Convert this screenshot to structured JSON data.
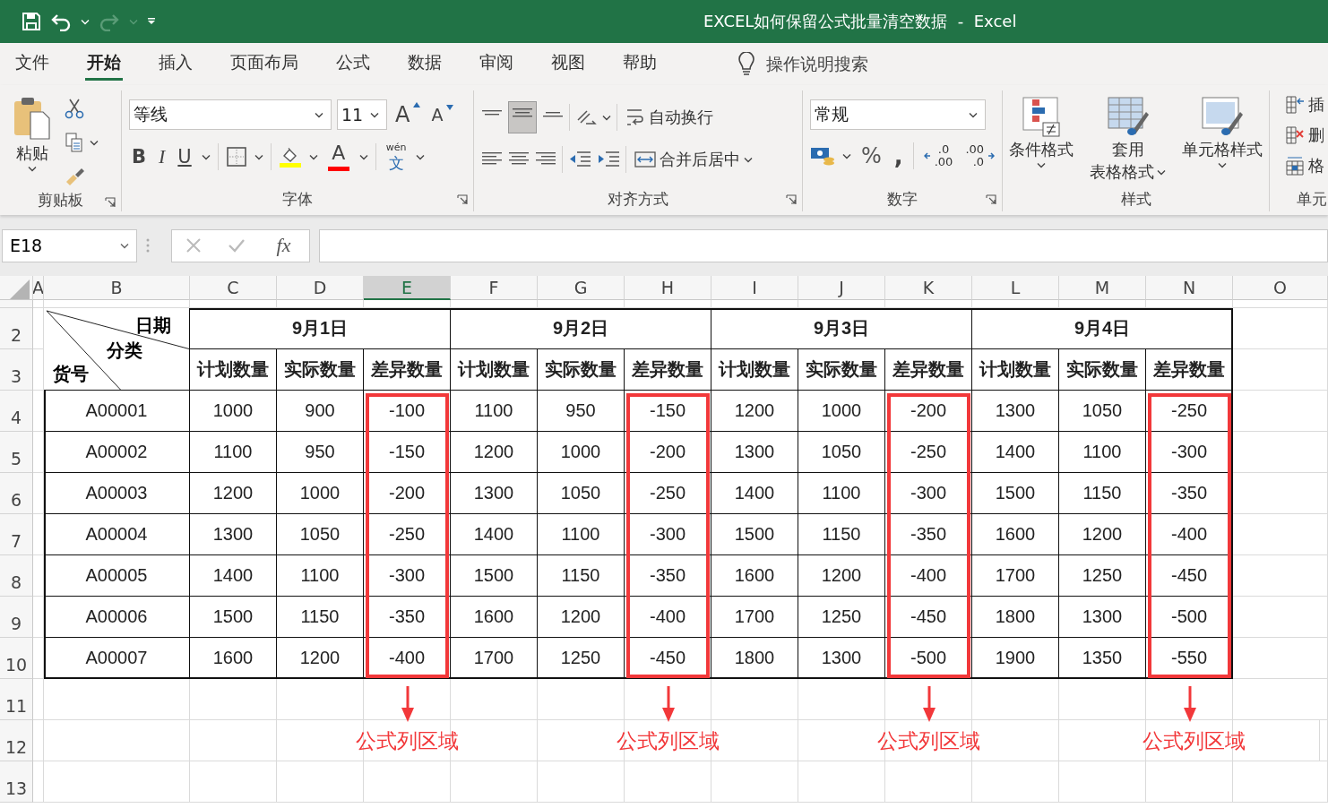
{
  "title_bar": {
    "title": "EXCEL如何保留公式批量清空数据  -  Excel"
  },
  "menu_tabs": [
    {
      "label": "文件",
      "selected": false
    },
    {
      "label": "开始",
      "selected": true
    },
    {
      "label": "插入",
      "selected": false
    },
    {
      "label": "页面布局",
      "selected": false
    },
    {
      "label": "公式",
      "selected": false
    },
    {
      "label": "数据",
      "selected": false
    },
    {
      "label": "审阅",
      "selected": false
    },
    {
      "label": "视图",
      "selected": false
    },
    {
      "label": "帮助",
      "selected": false
    }
  ],
  "tell_me": "操作说明搜索",
  "ribbon": {
    "clipboard": {
      "paste": "粘贴",
      "label": "剪贴板"
    },
    "font": {
      "font_name": "等线",
      "font_size": "11",
      "grow": "A",
      "shrink": "A",
      "bold": "B",
      "italic": "I",
      "underline": "U",
      "font_color": "A",
      "phonetic_top": "wén",
      "phonetic": "文",
      "label": "字体"
    },
    "alignment": {
      "wrap": "自动换行",
      "merge": "合并后居中",
      "label": "对齐方式"
    },
    "number": {
      "format": "常规",
      "percent": "%",
      "comma": ",",
      "increase_decimal": [
        ".0",
        ".00"
      ],
      "decrease_decimal": [
        ".00",
        ".0"
      ],
      "label": "数字"
    },
    "styles": {
      "conditional": "条件格式",
      "table_format": [
        "套用",
        "表格格式"
      ],
      "cell_styles": "单元格样式",
      "label": "样式"
    },
    "cells": {
      "insert": "插",
      "delete": "删",
      "format": "格",
      "label": "单元"
    }
  },
  "name_box": "E18",
  "formula_bar": {
    "fx": "fx"
  },
  "columns": [
    {
      "letter": "A",
      "selected": false
    },
    {
      "letter": "B",
      "selected": false
    },
    {
      "letter": "C",
      "selected": false
    },
    {
      "letter": "D",
      "selected": false
    },
    {
      "letter": "E",
      "selected": true
    },
    {
      "letter": "F",
      "selected": false
    },
    {
      "letter": "G",
      "selected": false
    },
    {
      "letter": "H",
      "selected": false
    },
    {
      "letter": "I",
      "selected": false
    },
    {
      "letter": "J",
      "selected": false
    },
    {
      "letter": "K",
      "selected": false
    },
    {
      "letter": "L",
      "selected": false
    },
    {
      "letter": "M",
      "selected": false
    },
    {
      "letter": "N",
      "selected": false
    },
    {
      "letter": "O",
      "selected": false
    }
  ],
  "rows": [
    "2",
    "3",
    "4",
    "5",
    "6",
    "7",
    "8",
    "9",
    "10",
    "11",
    "12",
    "13"
  ],
  "table": {
    "corner": {
      "top": "日期",
      "middle": "分类",
      "bottom": "货号"
    },
    "groups": [
      {
        "date": "9月1日",
        "headers": [
          "计划数量",
          "实际数量",
          "差异数量"
        ],
        "formula_note": "公式列区域"
      },
      {
        "date": "9月2日",
        "headers": [
          "计划数量",
          "实际数量",
          "差异数量"
        ],
        "formula_note": "公式列区域"
      },
      {
        "date": "9月3日",
        "headers": [
          "计划数量",
          "实际数量",
          "差异数量"
        ],
        "formula_note": "公式列区域"
      },
      {
        "date": "9月4日",
        "headers": [
          "计划数量",
          "实际数量",
          "差异数量"
        ],
        "formula_note": "公式列区域"
      }
    ],
    "rows": [
      {
        "id": "A00001",
        "cells": [
          "1000",
          "900",
          "-100",
          "1100",
          "950",
          "-150",
          "1200",
          "1000",
          "-200",
          "1300",
          "1050",
          "-250"
        ]
      },
      {
        "id": "A00002",
        "cells": [
          "1100",
          "950",
          "-150",
          "1200",
          "1000",
          "-200",
          "1300",
          "1050",
          "-250",
          "1400",
          "1100",
          "-300"
        ]
      },
      {
        "id": "A00003",
        "cells": [
          "1200",
          "1000",
          "-200",
          "1300",
          "1050",
          "-250",
          "1400",
          "1100",
          "-300",
          "1500",
          "1150",
          "-350"
        ]
      },
      {
        "id": "A00004",
        "cells": [
          "1300",
          "1050",
          "-250",
          "1400",
          "1100",
          "-300",
          "1500",
          "1150",
          "-350",
          "1600",
          "1200",
          "-400"
        ]
      },
      {
        "id": "A00005",
        "cells": [
          "1400",
          "1100",
          "-300",
          "1500",
          "1150",
          "-350",
          "1600",
          "1200",
          "-400",
          "1700",
          "1250",
          "-450"
        ]
      },
      {
        "id": "A00006",
        "cells": [
          "1500",
          "1150",
          "-350",
          "1600",
          "1200",
          "-400",
          "1700",
          "1250",
          "-450",
          "1800",
          "1300",
          "-500"
        ]
      },
      {
        "id": "A00007",
        "cells": [
          "1600",
          "1200",
          "-400",
          "1700",
          "1250",
          "-450",
          "1800",
          "1300",
          "-500",
          "1900",
          "1350",
          "-550"
        ]
      }
    ]
  }
}
